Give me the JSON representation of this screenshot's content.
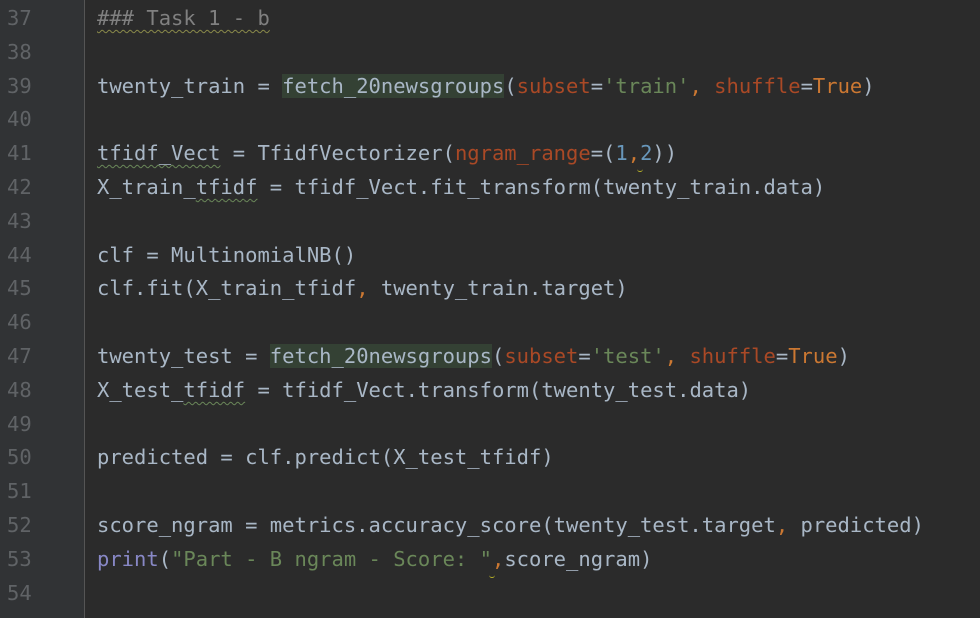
{
  "editor": {
    "line_numbers": [
      "37",
      "38",
      "39",
      "40",
      "41",
      "42",
      "43",
      "44",
      "45",
      "46",
      "47",
      "48",
      "49",
      "50",
      "51",
      "52",
      "53",
      "54"
    ],
    "line37": {
      "comment": "### Task 1 - b"
    },
    "line39": {
      "var": "twenty_train",
      "op": " = ",
      "func": "fetch_20newsgroups",
      "open": "(",
      "p1": "subset",
      "eq1": "=",
      "s1": "'train'",
      "comma": ", ",
      "p2": "shuffle",
      "eq2": "=",
      "kw": "True",
      "close": ")"
    },
    "line41": {
      "var": "tfidf_Vect",
      "op": " = ",
      "func": "TfidfVectorizer(",
      "p1": "ngram_range",
      "eq": "=(",
      "n1": "1",
      "comma": ",",
      "n2": "2",
      "close": "))"
    },
    "line42": {
      "var_a": "X_train_",
      "var_b": "tfidf",
      "rest": " = tfidf_Vect.fit_transform(twenty_train.data)"
    },
    "line44": {
      "text": "clf = MultinomialNB()"
    },
    "line45": {
      "a": "clf.fit(X_train_tfidf",
      "comma": ", ",
      "b": "twenty_train.target)"
    },
    "line47": {
      "var": "twenty_test",
      "op": " = ",
      "func": "fetch_20newsgroups",
      "open": "(",
      "p1": "subset",
      "eq1": "=",
      "s1": "'test'",
      "comma": ", ",
      "p2": "shuffle",
      "eq2": "=",
      "kw": "True",
      "close": ")"
    },
    "line48": {
      "var_a": "X_test_",
      "var_b": "tfidf",
      "rest": " = tfidf_Vect.transform(twenty_test.data)"
    },
    "line50": {
      "text": "predicted = clf.predict(X_test_tfidf)"
    },
    "line52": {
      "a": "score_ngram = metrics.accuracy_score(twenty_test.target",
      "comma": ", ",
      "b": "predicted)"
    },
    "line53": {
      "builtin": "print",
      "open": "(",
      "str": "\"Part - B ngram - Score: \"",
      "comma": ",",
      "rest": "score_ngram)"
    }
  }
}
